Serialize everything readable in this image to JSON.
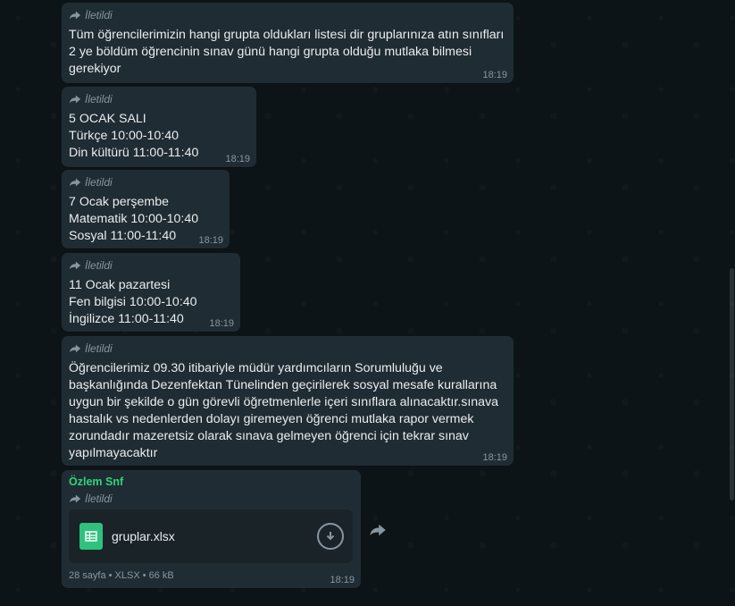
{
  "forwarded_label": "İletildi",
  "messages": [
    {
      "text": "Tüm öğrencilerimizin hangi grupta oldukları listesi dir gruplarınıza atın sınıfları 2 ye böldüm öğrencinin sınav günü hangi grupta olduğu mutlaka bilmesi gerekiyor",
      "time": "18:19"
    },
    {
      "text": "5 OCAK SALI\nTürkçe 10:00-10:40\nDin kültürü 11:00-11:40",
      "time": "18:19"
    },
    {
      "text": "7 Ocak perşembe\nMatematik 10:00-10:40\nSosyal 11:00-11:40",
      "time": "18:19"
    },
    {
      "text": "11 Ocak pazartesi\nFen bilgisi 10:00-10:40\nİngilizce 11:00-11:40",
      "time": "18:19"
    },
    {
      "text": "Öğrencilerimiz 09.30 itibariyle müdür yardımcıların Sorumluluğu ve başkanlığında Dezenfektan Tünelinden geçirilerek sosyal mesafe kurallarına uygun bir şekilde o gün görevli öğretmenlerle içeri sınıflara alınacaktır.sınava hastalık vs nedenlerden dolayı giremeyen öğrenci mutlaka rapor vermek zorundadır mazeretsiz olarak sınava gelmeyen öğrenci için tekrar sınav yapılmayacaktır",
      "time": "18:19"
    }
  ],
  "document_message": {
    "sender": "Özlem Snf",
    "file_name": "gruplar.xlsx",
    "meta": "28 sayfa • XLSX • 66 kB",
    "time": "18:19"
  },
  "colors": {
    "bubble": "#202c33",
    "text": "#e9edef",
    "meta": "#8696a0",
    "sender": "#2ed47a",
    "file_icon": "#2ec27e"
  }
}
